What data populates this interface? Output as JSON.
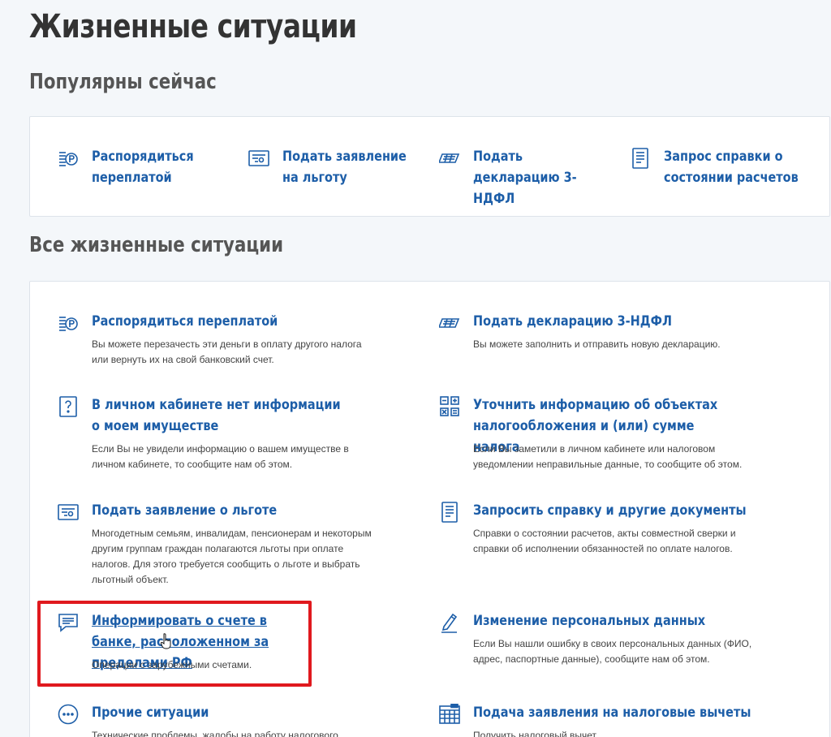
{
  "page": {
    "title": "Жизненные ситуации"
  },
  "popular": {
    "heading": "Популярны сейчас",
    "items": [
      {
        "label": "Распорядиться переплатой",
        "icon": "ruble-coin-icon"
      },
      {
        "label": "Подать заявление на льготу",
        "icon": "certificate-icon"
      },
      {
        "label": "Подать декларацию 3-НДФЛ",
        "icon": "tax-declaration-icon"
      },
      {
        "label": "Запрос справки о состоянии расчетов",
        "icon": "document-list-icon"
      }
    ]
  },
  "all": {
    "heading": "Все жизненные ситуации",
    "items": [
      {
        "title": "Распорядиться переплатой",
        "desc": "Вы можете перезачесть эти деньги в оплату другого налога или вернуть их на свой банковский счет.",
        "icon": "ruble-coin-icon"
      },
      {
        "title": "Подать декларацию 3-НДФЛ",
        "desc": "Вы можете заполнить и отправить новую декларацию.",
        "icon": "tax-declaration-icon"
      },
      {
        "title": "В личном кабинете нет информации о моем имуществе",
        "desc": "Если Вы не увидели информацию о вашем имуществе в личном кабинете, то сообщите нам об этом.",
        "icon": "question-icon"
      },
      {
        "title": "Уточнить информацию об объектах налогообложения и (или) сумме налога",
        "desc": "Если Вы заметили в личном кабинете или налоговом уведомлении неправильные данные, то сообщите об этом.",
        "icon": "calculator-icon"
      },
      {
        "title": "Подать заявление о льготе",
        "desc": "Многодетным семьям, инвалидам, пенсионерам и некоторым другим группам граждан полагаются льготы при оплате налогов. Для этого требуется сообщить о льготе и выбрать льготный объект.",
        "icon": "certificate-icon"
      },
      {
        "title": "Запросить справку и другие документы",
        "desc": "Справки о состоянии расчетов, акты совместной сверки и справки об исполнении обязанностей по оплате налогов.",
        "icon": "document-list-icon"
      },
      {
        "title": "Информировать о счете в банке, расположенном за пределами РФ",
        "desc": "Операции с зарубежными счетами.",
        "icon": "message-icon"
      },
      {
        "title": "Изменение персональных данных",
        "desc": "Если Вы нашли ошибку в своих персональных данных (ФИО, адрес, паспортные данные), сообщите нам об этом.",
        "icon": "pencil-icon"
      },
      {
        "title": "Прочие ситуации",
        "desc": "Технические проблемы, жалобы на работу налогового",
        "icon": "more-dots-icon"
      },
      {
        "title": "Подача заявления на налоговые вычеты",
        "desc": "Получить налоговый вычет",
        "icon": "calendar-grid-icon"
      }
    ]
  },
  "colors": {
    "link": "#1d5ea8",
    "highlight": "#e0191e",
    "background": "#f4f7fa"
  }
}
